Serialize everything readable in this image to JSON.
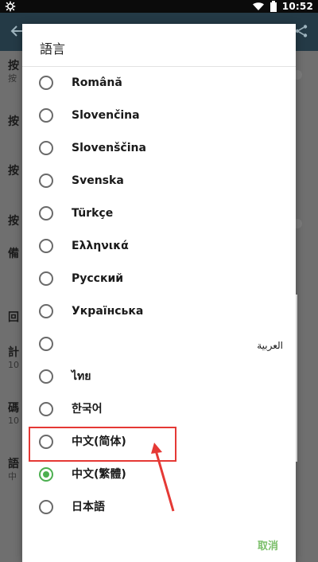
{
  "status_bar": {
    "time": "10:52",
    "icons": [
      "settings-icon",
      "wifi-icon",
      "battery-icon"
    ]
  },
  "background": {
    "rows": [
      {
        "title": "按",
        "subtitle": "按"
      },
      {
        "title": "按",
        "subtitle": ""
      },
      {
        "title": "按",
        "subtitle": ""
      },
      {
        "title": "按",
        "subtitle": ""
      },
      {
        "title": "備",
        "subtitle": ""
      },
      {
        "title": "回",
        "subtitle": ""
      },
      {
        "title": "計",
        "subtitle": "10"
      },
      {
        "title": "碼",
        "subtitle": "10"
      },
      {
        "title": "語",
        "subtitle": "中"
      }
    ]
  },
  "dialog": {
    "title": "語言",
    "options": [
      {
        "label": "Română",
        "checked": false
      },
      {
        "label": "Slovenčina",
        "checked": false
      },
      {
        "label": "Slovenščina",
        "checked": false
      },
      {
        "label": "Svenska",
        "checked": false
      },
      {
        "label": "Türkçe",
        "checked": false
      },
      {
        "label": "Ελληνικά",
        "checked": false
      },
      {
        "label": "Русский",
        "checked": false
      },
      {
        "label": "Українська",
        "checked": false
      },
      {
        "label": "العربية",
        "checked": false
      },
      {
        "label": "ไทย",
        "checked": false
      },
      {
        "label": "한국어",
        "checked": false
      },
      {
        "label": "中文(简体)",
        "checked": false
      },
      {
        "label": "中文(繁體)",
        "checked": true
      },
      {
        "label": "日本語",
        "checked": false
      }
    ],
    "cancel_label": "取消"
  },
  "colors": {
    "accent": "#4caf50",
    "cancel_text": "#7bbf6a",
    "highlight": "#e53935",
    "toolbar": "#243a46"
  }
}
